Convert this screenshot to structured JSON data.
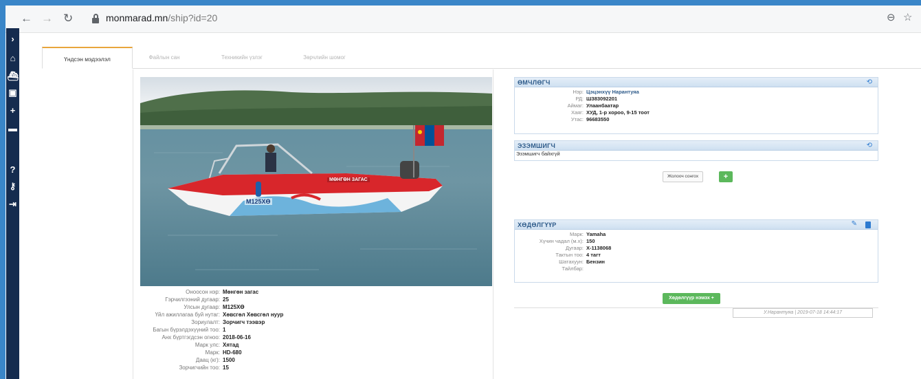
{
  "browser": {
    "url_host": "monmarad.mn",
    "url_path": "/ship?id=20"
  },
  "tabs": [
    {
      "label": "Үндсэн мэдээлэл",
      "active": true
    },
    {
      "label": "Файлын сан",
      "active": false
    },
    {
      "label": "Техникийн үзлэг",
      "active": false
    },
    {
      "label": "Зөрчлийн шомог",
      "active": false
    }
  ],
  "boat": {
    "registration_plate": "M125XӨ",
    "hull_text": "МӨНГӨН ЗАГАС"
  },
  "ship_info": [
    {
      "label": "Оноосон нэр:",
      "value": "Мөнгөн загас"
    },
    {
      "label": "Гэрчилгээний дугаар:",
      "value": "25"
    },
    {
      "label": "Улсын дугаар:",
      "value": "M125XӨ"
    },
    {
      "label": "Үйл ажиллагаа буй нутаг:",
      "value": "Хөвсгөл Хөвсгөл нуур"
    },
    {
      "label": "Зориулалт:",
      "value": "Зорчигч тээвэр"
    },
    {
      "label": "Багын бүрэлдэхүүний тоо:",
      "value": "1"
    },
    {
      "label": "Анх бүртгэгдсэн огноо:",
      "value": "2018-06-16"
    },
    {
      "label": "Марк улс:",
      "value": "Хятад"
    },
    {
      "label": "Марк:",
      "value": "HD-680"
    },
    {
      "label": "Даац (кг):",
      "value": "1500"
    },
    {
      "label": "Зорчигчийн тоо:",
      "value": "15"
    }
  ],
  "owner_panel": {
    "title": "ӨМЧЛӨГЧ",
    "rows": [
      {
        "label": "Нэр:",
        "value": "Цэцэнхүү Нарантуяа"
      },
      {
        "label": "РД:",
        "value": "Ш383092201"
      },
      {
        "label": "Аймаг:",
        "value": "Улаанбаатар"
      },
      {
        "label": "Хаяг:",
        "value": "ХУД, 1-р хороо, 9-15 тоот"
      },
      {
        "label": "Утас:",
        "value": "96683550"
      }
    ]
  },
  "possessor_panel": {
    "title": "ЭЗЭМШИГЧ",
    "empty_text": "Эзэмшигч байхгүй"
  },
  "search_button_label": "Жолооч сонгох",
  "add_button_label": "+",
  "engine_panel": {
    "title": "ХӨДӨЛГҮҮР",
    "rows": [
      {
        "label": "Марк:",
        "value": "Yamaha"
      },
      {
        "label": "Хүчин чадал (м.х):",
        "value": "150"
      },
      {
        "label": "Дугаар:",
        "value": "X-1138068"
      },
      {
        "label": "Тактын тоо:",
        "value": "4 тагт"
      },
      {
        "label": "Шатахуун:",
        "value": "Бензин"
      },
      {
        "label": "Тайлбар:",
        "value": ""
      }
    ]
  },
  "add_engine_label": "Хөдөлгүүр нэмэх +",
  "stamp_text": "У.Нарантуяа | 2019-07-18 14:44:17",
  "colors": {
    "sidebar": "#152c4f",
    "panel_header": "#cfe0f1",
    "green_button": "#5cb85c",
    "active_tab_accent": "#e8a53c"
  }
}
